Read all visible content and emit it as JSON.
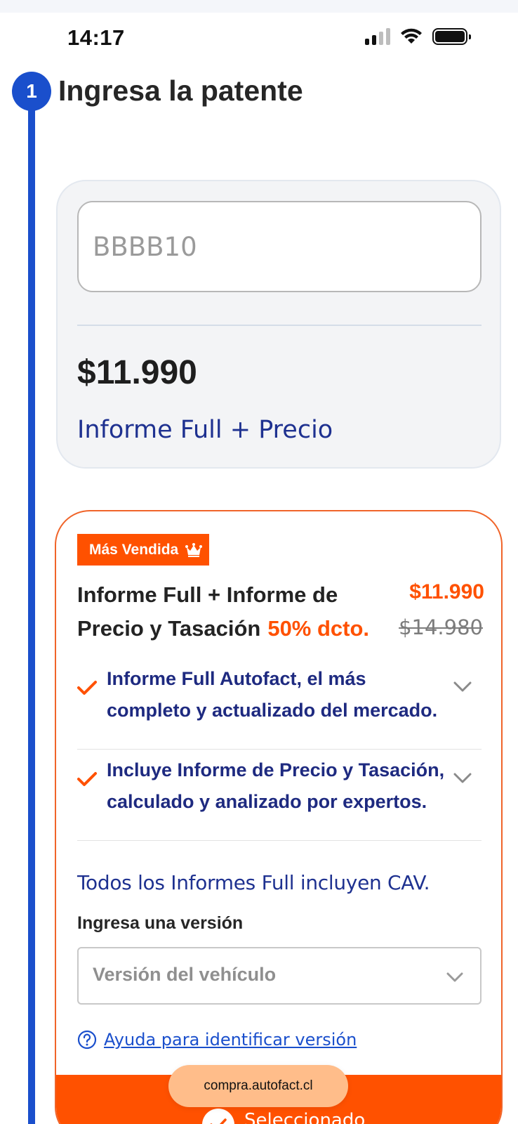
{
  "status_bar": {
    "time": "14:17"
  },
  "step": {
    "number": "1",
    "title": "Ingresa la patente"
  },
  "plate_card": {
    "input_placeholder": "BBBB10",
    "price": "$11.990",
    "plan_name": "Informe Full + Precio"
  },
  "offer": {
    "badge": "Más Vendida",
    "title": "Informe Full + Informe de Precio y Tasación",
    "discount": "50% dcto.",
    "price": "$11.990",
    "old_price": "$14.980",
    "features": [
      {
        "text": "Informe Full Autofact, el más completo y actualizado del mercado."
      },
      {
        "text": "Incluye Informe de Precio y Tasación, calculado y analizado por expertos."
      }
    ],
    "cav_note": "Todos los Informes Full incluyen CAV.",
    "version_label": "Ingresa una versión",
    "version_placeholder": "Versión del vehículo",
    "help_link": "Ayuda para identificar versión",
    "selected_label": "Seleccionado"
  },
  "browser": {
    "url": "compra.autofact.cl"
  },
  "colors": {
    "brand_blue": "#1a4fcc",
    "accent_orange": "#ff5100",
    "text_navy": "#1e2a80"
  }
}
